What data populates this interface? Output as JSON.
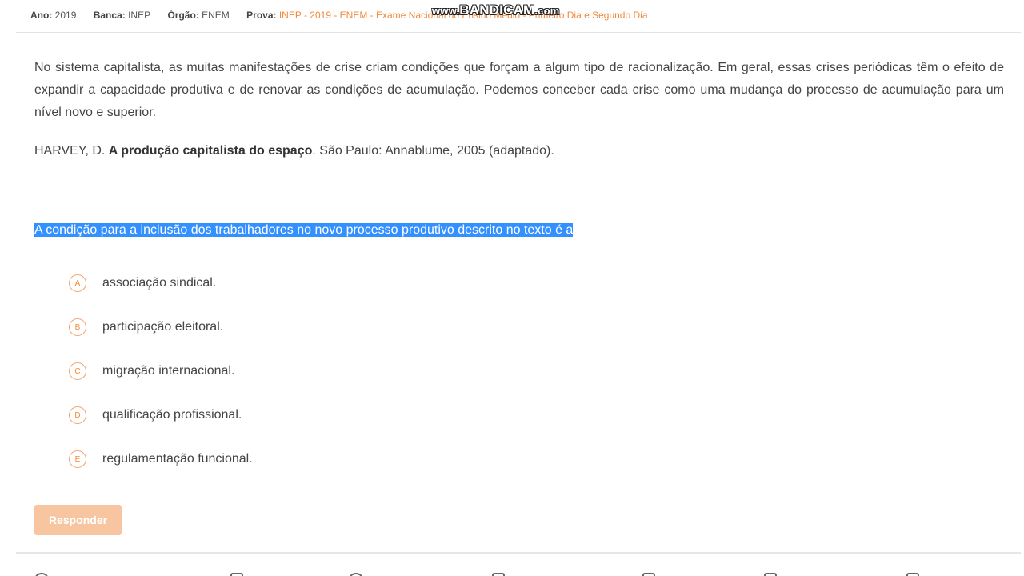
{
  "header": {
    "ano_label": "Ano:",
    "ano_value": "2019",
    "banca_label": "Banca:",
    "banca_value": "INEP",
    "orgao_label": "Órgão:",
    "orgao_value": "ENEM",
    "prova_label": "Prova:",
    "prova_value": "INEP - 2019 - ENEM - Exame Nacional do Ensino Médio - Primeiro Dia e Segundo Dia"
  },
  "watermark": {
    "prefix": "www.",
    "brand": "BANDICAM",
    "suffix": ".com"
  },
  "question": {
    "passage": "No sistema capitalista, as muitas manifestações de crise criam condições que forçam a algum tipo de racionalização. Em geral, essas crises periódicas têm o efeito de expandir a capacidade produtiva e de renovar as condições de acumulação. Podemos conceber cada crise como uma mudança do processo de acumulação para um nível novo e superior.",
    "reference_author": "HARVEY, D.",
    "reference_title": "A produção capitalista do espaço",
    "reference_rest": ". São Paulo: Annablume, 2005 (adaptado).",
    "prompt": "A condição para a inclusão dos trabalhadores no novo processo produtivo descrito no texto é a"
  },
  "options": [
    {
      "letter": "A",
      "text": "associação sindical."
    },
    {
      "letter": "B",
      "text": "participação eleitoral."
    },
    {
      "letter": "C",
      "text": "migração internacional."
    },
    {
      "letter": "D",
      "text": "qualificação profissional."
    },
    {
      "letter": "E",
      "text": "regulamentação funcional."
    }
  ],
  "actions": {
    "answer_label": "Responder"
  },
  "colors": {
    "accent": "#f08a3c",
    "button_disabled": "#f7c6a0",
    "selection": "#3390ff"
  }
}
